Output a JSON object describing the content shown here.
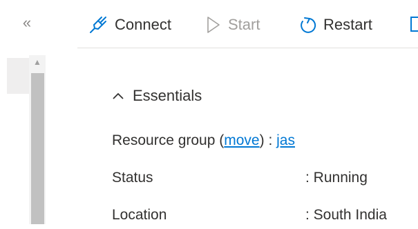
{
  "sidebar": {
    "collapse_glyph": "«",
    "scroll_up_glyph": "▲"
  },
  "toolbar": {
    "connect_label": "Connect",
    "start_label": "Start",
    "restart_label": "Restart"
  },
  "essentials": {
    "header": "Essentials",
    "rows": [
      {
        "label": "Resource group",
        "label_link": "move",
        "label_link_pre": " (",
        "label_link_post": ")",
        "sep": " : ",
        "value": "jas",
        "value_is_link": true
      },
      {
        "label": "Status",
        "sep": ": ",
        "value": "Running"
      },
      {
        "label": "Location",
        "sep": ": ",
        "value": "South India"
      }
    ]
  },
  "colors": {
    "accent": "#0078d4",
    "text": "#323130",
    "disabled": "#a19f9d"
  }
}
